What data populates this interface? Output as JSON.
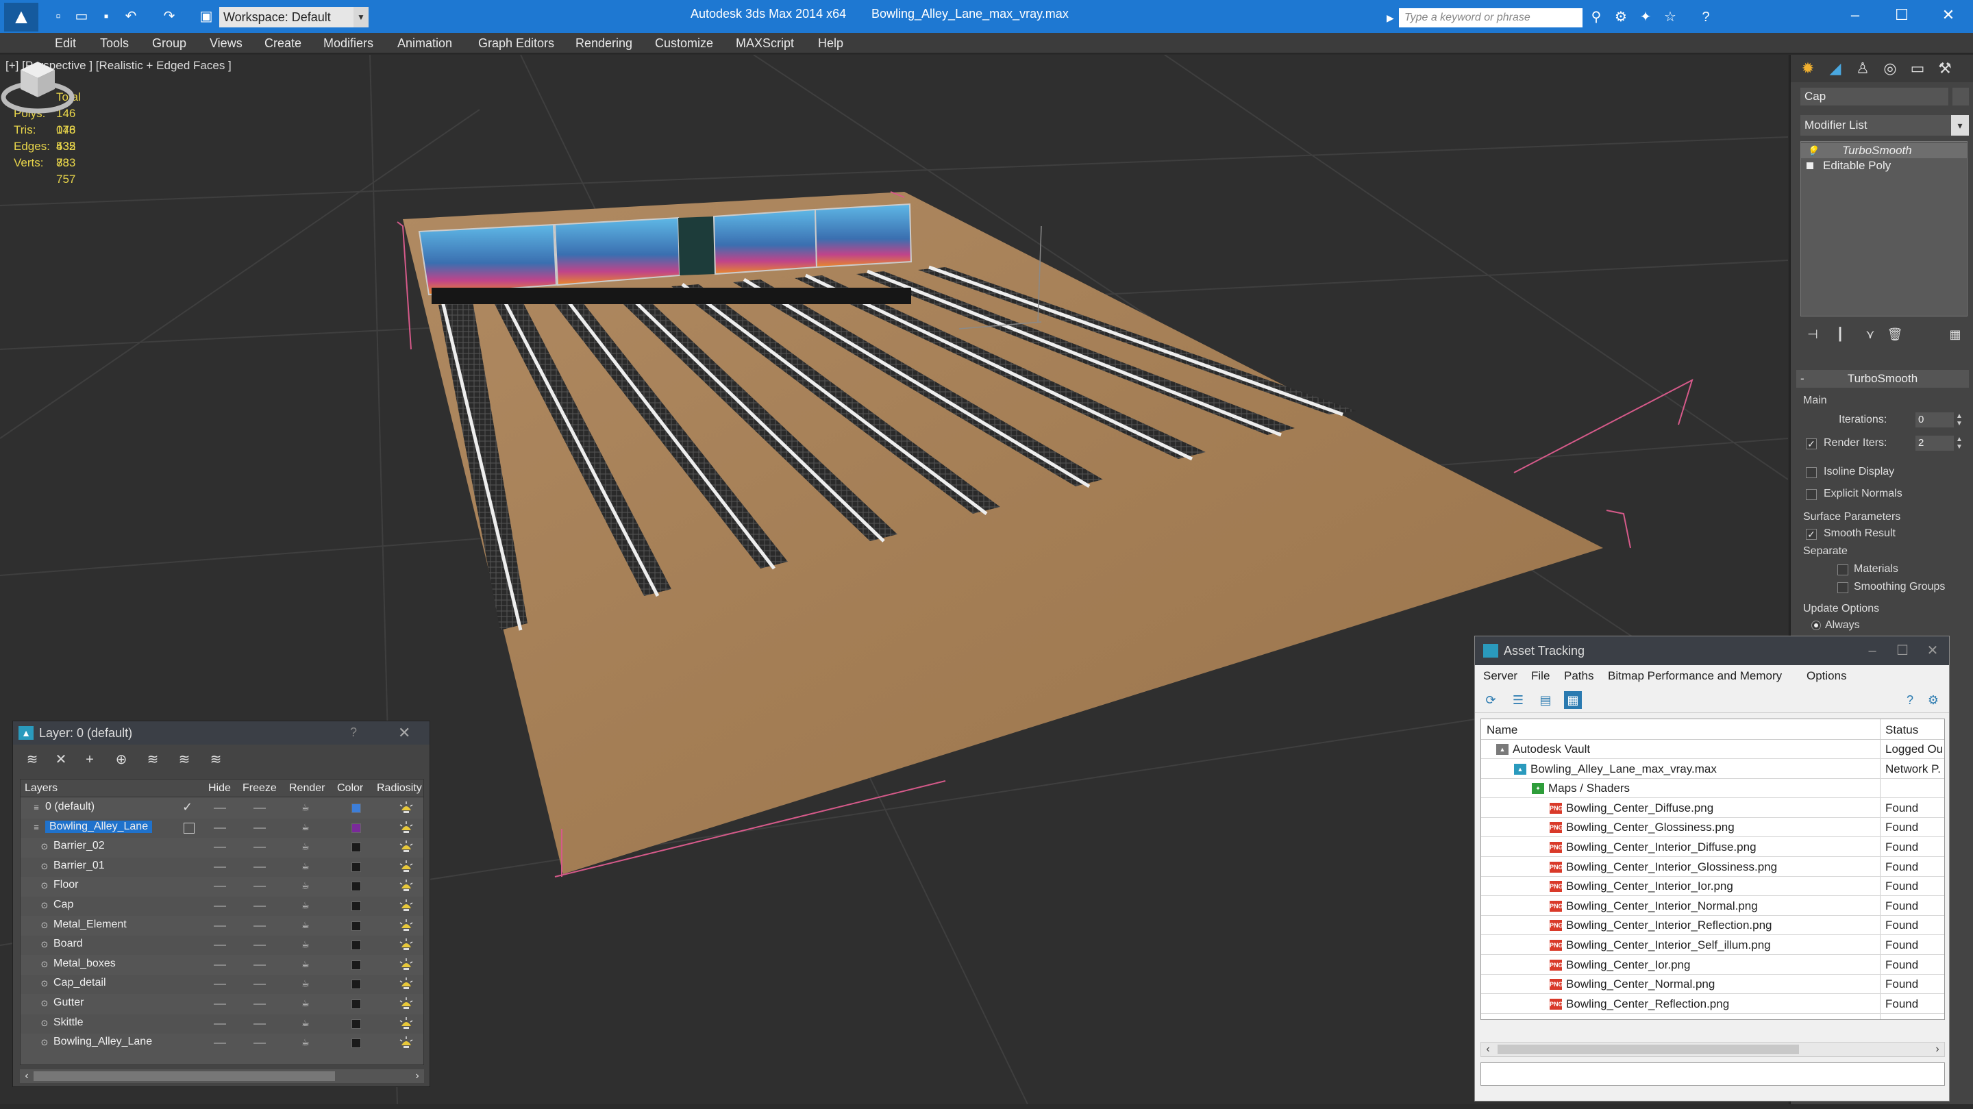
{
  "titlebar": {
    "workspace_label": "Workspace: Default",
    "app_title": "Autodesk 3ds Max  2014 x64",
    "file_title": "Bowling_Alley_Lane_max_vray.max",
    "search_placeholder": "Type a keyword or phrase",
    "window_buttons": [
      "–",
      "☐",
      "✕"
    ]
  },
  "menu": [
    "Edit",
    "Tools",
    "Group",
    "Views",
    "Create",
    "Modifiers",
    "Animation",
    "Graph Editors",
    "Rendering",
    "Customize",
    "MAXScript",
    "Help"
  ],
  "viewport": {
    "label": "[+] [Perspective ] [Realistic + Edged Faces ]",
    "stats": {
      "header": "Total",
      "rows": [
        {
          "key": "Polys:",
          "value": "146 076"
        },
        {
          "key": "Tris:",
          "value": "148 532"
        },
        {
          "key": "Edges:",
          "value": "435 833"
        },
        {
          "key": "Verts:",
          "value": "78 757"
        }
      ]
    }
  },
  "command_panel": {
    "object_name": "Cap",
    "modifier_list": "Modifier List",
    "stack": [
      "TurboSmooth",
      "Editable Poly"
    ],
    "rollout": {
      "title": "TurboSmooth",
      "main_label": "Main",
      "iterations_label": "Iterations:",
      "iterations_value": "0",
      "render_iters_label": "Render Iters:",
      "render_iters_value": "2",
      "render_iters_checked": true,
      "isoline_label": "Isoline Display",
      "explicit_label": "Explicit Normals",
      "surface_label": "Surface Parameters",
      "smooth_result_label": "Smooth Result",
      "smooth_result_checked": true,
      "separate_label": "Separate",
      "materials_label": "Materials",
      "smoothing_groups_label": "Smoothing Groups",
      "update_label": "Update Options",
      "always_label": "Always"
    }
  },
  "layer_window": {
    "title": "Layer: 0 (default)",
    "help": "?",
    "close": "✕",
    "columns": [
      "Layers",
      "Hide",
      "Freeze",
      "Render",
      "Color",
      "Radiosity"
    ],
    "rows": [
      {
        "name": "0 (default)",
        "level": 0,
        "color": "#3d7ed8",
        "check": true
      },
      {
        "name": "Bowling_Alley_Lane",
        "level": 0,
        "color": "#7a2a9a",
        "selected": true
      },
      {
        "name": "Barrier_02",
        "level": 1,
        "color": "#1a1a1a"
      },
      {
        "name": "Barrier_01",
        "level": 1,
        "color": "#1a1a1a"
      },
      {
        "name": "Floor",
        "level": 1,
        "color": "#1a1a1a"
      },
      {
        "name": "Cap",
        "level": 1,
        "color": "#1a1a1a"
      },
      {
        "name": "Metal_Element",
        "level": 1,
        "color": "#1a1a1a"
      },
      {
        "name": "Board",
        "level": 1,
        "color": "#1a1a1a"
      },
      {
        "name": "Metal_boxes",
        "level": 1,
        "color": "#1a1a1a"
      },
      {
        "name": "Cap_detail",
        "level": 1,
        "color": "#1a1a1a"
      },
      {
        "name": "Gutter",
        "level": 1,
        "color": "#1a1a1a"
      },
      {
        "name": "Skittle",
        "level": 1,
        "color": "#1a1a1a"
      },
      {
        "name": "Bowling_Alley_Lane",
        "level": 1,
        "color": "#1a1a1a"
      }
    ]
  },
  "asset_window": {
    "title": "Asset Tracking",
    "menu": [
      "Server",
      "File",
      "Paths",
      "Bitmap Performance and Memory",
      "Options"
    ],
    "columns": [
      "Name",
      "Status"
    ],
    "rows": [
      {
        "name": "Autodesk Vault",
        "status": "Logged Ou",
        "level": 0,
        "icon": "vault"
      },
      {
        "name": "Bowling_Alley_Lane_max_vray.max",
        "status": "Network P.",
        "level": 1,
        "icon": "max"
      },
      {
        "name": "Maps / Shaders",
        "status": "",
        "level": 2,
        "icon": "maps"
      },
      {
        "name": "Bowling_Center_Diffuse.png",
        "status": "Found",
        "level": 3,
        "icon": "png"
      },
      {
        "name": "Bowling_Center_Glossiness.png",
        "status": "Found",
        "level": 3,
        "icon": "png"
      },
      {
        "name": "Bowling_Center_Interior_Diffuse.png",
        "status": "Found",
        "level": 3,
        "icon": "png"
      },
      {
        "name": "Bowling_Center_Interior_Glossiness.png",
        "status": "Found",
        "level": 3,
        "icon": "png"
      },
      {
        "name": "Bowling_Center_Interior_Ior.png",
        "status": "Found",
        "level": 3,
        "icon": "png"
      },
      {
        "name": "Bowling_Center_Interior_Normal.png",
        "status": "Found",
        "level": 3,
        "icon": "png"
      },
      {
        "name": "Bowling_Center_Interior_Reflection.png",
        "status": "Found",
        "level": 3,
        "icon": "png"
      },
      {
        "name": "Bowling_Center_Interior_Self_illum.png",
        "status": "Found",
        "level": 3,
        "icon": "png"
      },
      {
        "name": "Bowling_Center_Ior.png",
        "status": "Found",
        "level": 3,
        "icon": "png"
      },
      {
        "name": "Bowling_Center_Normal.png",
        "status": "Found",
        "level": 3,
        "icon": "png"
      },
      {
        "name": "Bowling_Center_Reflection.png",
        "status": "Found",
        "level": 3,
        "icon": "png"
      }
    ]
  }
}
